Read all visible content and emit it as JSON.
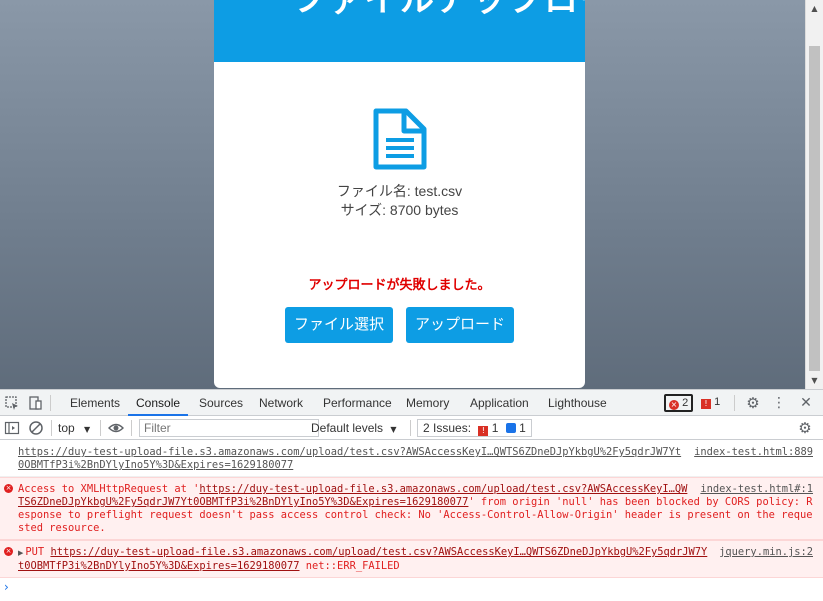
{
  "page": {
    "title": "ファイルアップロード",
    "file_name_line": "ファイル名: test.csv",
    "file_size_line": "サイズ: 8700 bytes",
    "error_message": "アップロードが失敗しました。",
    "select_button": "ファイル選択",
    "upload_button": "アップロード"
  },
  "devtools": {
    "tabs": [
      {
        "label": "Elements"
      },
      {
        "label": "Console"
      },
      {
        "label": "Sources"
      },
      {
        "label": "Network"
      },
      {
        "label": "Performance"
      },
      {
        "label": "Memory"
      },
      {
        "label": "Application"
      },
      {
        "label": "Lighthouse"
      }
    ],
    "active_tab": "Console",
    "error_count": "2",
    "issue_count": "1",
    "context": "top",
    "filter_placeholder": "Filter",
    "levels": "Default levels",
    "issues_label": "2 Issues:",
    "issues_red": "1",
    "issues_blue": "1"
  },
  "console": {
    "messages": [
      {
        "type": "log",
        "text": "https://duy-test-upload-file.s3.amazonaws.com/upload/test.csv?AWSAccessKeyI…QWTS6ZDneDJpYkbgU%2Fy5qdrJW7Yt0OBMTfP3i%2BnDYlyIno5Y%3D&Expires=1629180077",
        "source": "index-test.html:889"
      },
      {
        "type": "error",
        "prefix": "Access to XMLHttpRequest at '",
        "url": "https://duy-test-upload-file.s3.amazonaws.com/upload/test.csv?AWSAccessKeyI…QWTS6ZDneDJpYkbgU%2Fy5qdrJW7Yt0OBMTfP3i%2BnDYlyIno5Y%3D&Expires=1629180077",
        "suffix": "' from origin 'null' has been blocked by CORS policy: Response to preflight request doesn't pass access control check: No 'Access-Control-Allow-Origin' header is present on the requested resource.",
        "source": "index-test.html#:1"
      },
      {
        "type": "error",
        "method": "PUT",
        "url": "https://duy-test-upload-file.s3.amazonaws.com/upload/test.csv?AWSAccessKeyI…QWTS6ZDneDJpYkbgU%2Fy5qdrJW7Yt0OBMTfP3i%2BnDYlyIno5Y%3D&Expires=1629180077",
        "status": "net::ERR_FAILED",
        "source": "jquery.min.js:2"
      }
    ],
    "prompt": "›"
  },
  "colors": {
    "brand": "#0d9de4",
    "error": "#e00000"
  }
}
